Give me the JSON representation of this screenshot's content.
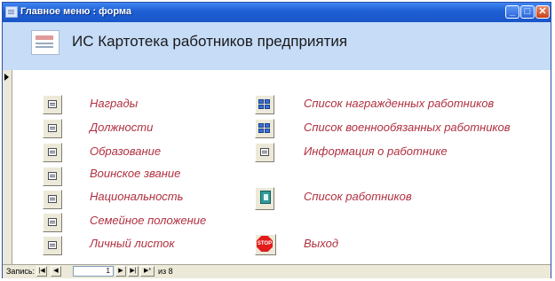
{
  "window": {
    "title": "Главное меню : форма"
  },
  "header": {
    "title": "ИС Картотека работников предприятия"
  },
  "left_menu": [
    {
      "label": "Награды",
      "icon": "form-icon"
    },
    {
      "label": "Должности",
      "icon": "form-icon"
    },
    {
      "label": "Образование",
      "icon": "form-icon"
    },
    {
      "label": "Воинское звание",
      "icon": "form-icon"
    },
    {
      "label": "Национальность",
      "icon": "form-icon"
    },
    {
      "label": "Семейное положение",
      "icon": "form-icon"
    },
    {
      "label": "Личный листок",
      "icon": "form-icon"
    }
  ],
  "right_menu": [
    {
      "label": "Список награжденных работников",
      "icon": "report-icon"
    },
    {
      "label": "Список военнообязанных работников",
      "icon": "report-icon"
    },
    {
      "label": "Информация о работнике",
      "icon": "form-icon"
    },
    {
      "label": "Список работников",
      "icon": "book-icon"
    },
    {
      "label": "Выход",
      "icon": "stop-icon",
      "icon_text": "STOP"
    }
  ],
  "record_nav": {
    "label": "Запись:",
    "current": "1",
    "of_text": "из 8",
    "first": "|◀",
    "prev": "◀",
    "next": "▶",
    "last": "▶|",
    "new": "▶*"
  },
  "colors": {
    "title_bar": "#1e5fd3",
    "header_bg": "#c6dcf7",
    "label": "#b03040",
    "control": "#ece9d8"
  }
}
